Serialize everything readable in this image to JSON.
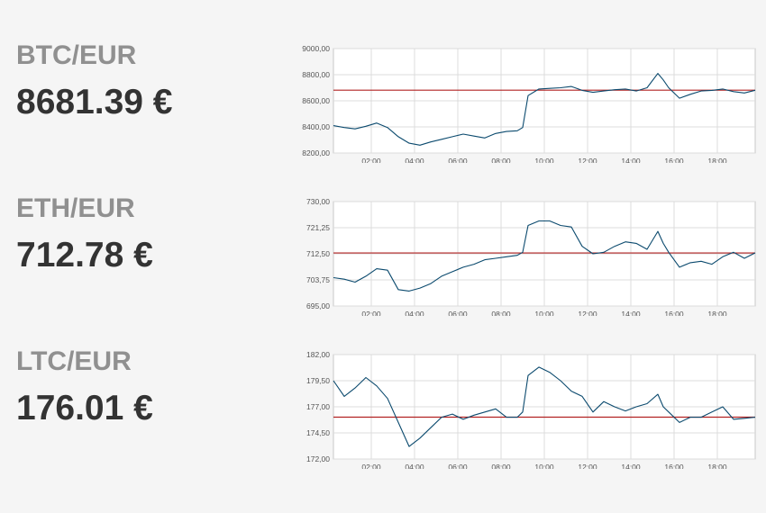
{
  "colors": {
    "line": "#0b4a6e",
    "reference": "#b22222",
    "grid": "#dcdcdc",
    "axis": "#888888"
  },
  "panels": [
    {
      "pair": "BTC/EUR",
      "price": "8681.39 €"
    },
    {
      "pair": "ETH/EUR",
      "price": "712.78 €"
    },
    {
      "pair": "LTC/EUR",
      "price": "176.01 €"
    }
  ],
  "chart_data": [
    {
      "type": "line",
      "title": "BTC/EUR",
      "x_ticks": [
        "02:00",
        "04:00",
        "06:00",
        "08:00",
        "10:00",
        "12:00",
        "14:00",
        "16:00",
        "18:00"
      ],
      "y_ticks": [
        "8200,00",
        "8400,00",
        "8600,00",
        "8800,00",
        "9000,00"
      ],
      "ylim": [
        8200,
        9000
      ],
      "xlim": [
        "00:15",
        "19:45"
      ],
      "reference_line": 8681.39,
      "series": [
        {
          "x": [
            "00:15",
            "00:45",
            "01:15",
            "01:45",
            "02:15",
            "02:45",
            "03:15",
            "03:45",
            "04:15",
            "04:45",
            "05:15",
            "05:45",
            "06:15",
            "06:45",
            "07:15",
            "07:45",
            "08:15",
            "08:45",
            "09:00",
            "09:15",
            "09:45",
            "10:15",
            "10:45",
            "11:15",
            "11:45",
            "12:15",
            "12:45",
            "13:15",
            "13:45",
            "14:15",
            "14:45",
            "15:15",
            "15:30",
            "15:45",
            "16:15",
            "16:45",
            "17:15",
            "17:45",
            "18:15",
            "18:45",
            "19:15",
            "19:45"
          ],
          "values": [
            8410,
            8395,
            8385,
            8405,
            8430,
            8395,
            8325,
            8275,
            8260,
            8285,
            8305,
            8325,
            8345,
            8330,
            8315,
            8350,
            8365,
            8370,
            8395,
            8640,
            8690,
            8695,
            8700,
            8710,
            8680,
            8665,
            8675,
            8685,
            8690,
            8675,
            8700,
            8810,
            8760,
            8700,
            8620,
            8650,
            8675,
            8680,
            8690,
            8670,
            8660,
            8681
          ]
        }
      ]
    },
    {
      "type": "line",
      "title": "ETH/EUR",
      "x_ticks": [
        "02:00",
        "04:00",
        "06:00",
        "08:00",
        "10:00",
        "12:00",
        "14:00",
        "16:00",
        "18:00"
      ],
      "y_ticks": [
        "695,00",
        "703,75",
        "712,50",
        "721,25",
        "730,00"
      ],
      "ylim": [
        695,
        730
      ],
      "xlim": [
        "00:15",
        "19:45"
      ],
      "reference_line": 712.78,
      "series": [
        {
          "x": [
            "00:15",
            "00:45",
            "01:15",
            "01:45",
            "02:15",
            "02:45",
            "03:15",
            "03:45",
            "04:15",
            "04:45",
            "05:15",
            "05:45",
            "06:15",
            "06:45",
            "07:15",
            "07:45",
            "08:15",
            "08:45",
            "09:00",
            "09:15",
            "09:45",
            "10:15",
            "10:45",
            "11:15",
            "11:45",
            "12:15",
            "12:45",
            "13:15",
            "13:45",
            "14:15",
            "14:45",
            "15:15",
            "15:30",
            "15:45",
            "16:15",
            "16:45",
            "17:15",
            "17:45",
            "18:15",
            "18:45",
            "19:15",
            "19:45"
          ],
          "values": [
            704.5,
            704,
            703,
            705,
            707.5,
            707,
            700.5,
            700,
            701,
            702.5,
            705,
            706.5,
            708,
            709,
            710.5,
            711,
            711.5,
            712,
            713,
            722,
            723.5,
            723.5,
            722,
            721.5,
            715,
            712.5,
            713,
            715,
            716.5,
            716,
            714,
            720,
            716,
            713,
            708,
            709.5,
            710,
            709,
            711.5,
            713,
            711,
            712.8
          ]
        }
      ]
    },
    {
      "type": "line",
      "title": "LTC/EUR",
      "x_ticks": [
        "02:00",
        "04:00",
        "06:00",
        "08:00",
        "10:00",
        "12:00",
        "14:00",
        "16:00",
        "18:00"
      ],
      "y_ticks": [
        "172,00",
        "174,50",
        "177,00",
        "179,50",
        "182,00"
      ],
      "ylim": [
        172,
        182
      ],
      "xlim": [
        "00:15",
        "19:45"
      ],
      "reference_line": 176.01,
      "series": [
        {
          "x": [
            "00:15",
            "00:45",
            "01:15",
            "01:45",
            "02:15",
            "02:45",
            "03:15",
            "03:45",
            "04:15",
            "04:45",
            "05:15",
            "05:45",
            "06:15",
            "06:45",
            "07:15",
            "07:45",
            "08:15",
            "08:45",
            "09:00",
            "09:15",
            "09:45",
            "10:15",
            "10:45",
            "11:15",
            "11:45",
            "12:15",
            "12:45",
            "13:15",
            "13:45",
            "14:15",
            "14:45",
            "15:15",
            "15:30",
            "15:45",
            "16:15",
            "16:45",
            "17:15",
            "17:45",
            "18:15",
            "18:45",
            "19:15",
            "19:45"
          ],
          "values": [
            179.5,
            178,
            178.8,
            179.8,
            179,
            177.8,
            175.5,
            173.2,
            174,
            175,
            176,
            176.3,
            175.8,
            176.2,
            176.5,
            176.8,
            176,
            176,
            176.5,
            180,
            180.8,
            180.3,
            179.5,
            178.5,
            178,
            176.5,
            177.5,
            177,
            176.6,
            177,
            177.3,
            178.2,
            177,
            176.5,
            175.5,
            176,
            176,
            176.5,
            177,
            175.8,
            175.9,
            176
          ]
        }
      ]
    }
  ]
}
